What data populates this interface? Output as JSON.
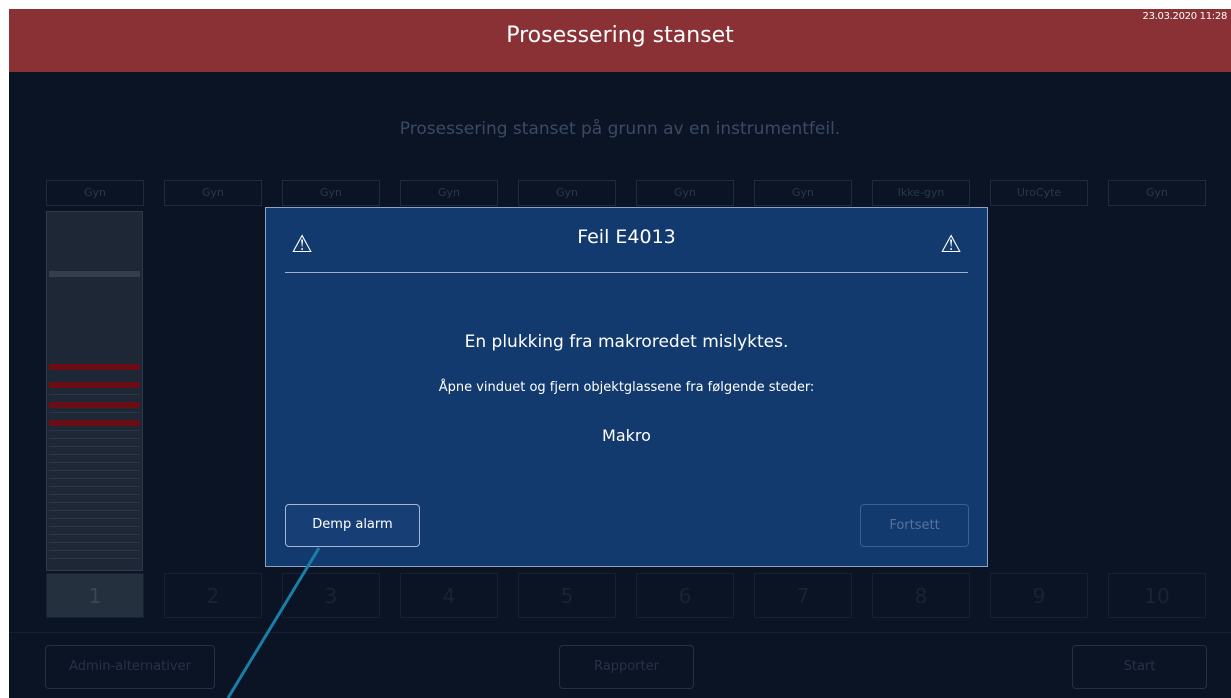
{
  "header": {
    "title": "Prosessering stanset",
    "datetime": "23.03.2020 11:28"
  },
  "status_message": "Prosessering stanset på grunn av en instrumentfeil.",
  "racks": [
    {
      "label": "Gyn",
      "number": "1"
    },
    {
      "label": "Gyn",
      "number": "2"
    },
    {
      "label": "Gyn",
      "number": "3"
    },
    {
      "label": "Gyn",
      "number": "4"
    },
    {
      "label": "Gyn",
      "number": "5"
    },
    {
      "label": "Gyn",
      "number": "6"
    },
    {
      "label": "Gyn",
      "number": "7"
    },
    {
      "label": "Ikke-gyn",
      "number": "8"
    },
    {
      "label": "UroCyte",
      "number": "9"
    },
    {
      "label": "Gyn",
      "number": "10"
    }
  ],
  "footer": {
    "admin_label": "Admin-alternativer",
    "reports_label": "Rapporter",
    "start_label": "Start"
  },
  "dialog": {
    "title": "Feil E4013",
    "icon": "warning-icon",
    "message": "En plukking fra makroredet mislyktes.",
    "instruction": "Åpne vinduet og fjern objektglassene fra følgende steder:",
    "location": "Makro",
    "mute_label": "Demp alarm",
    "continue_label": "Fortsett"
  },
  "colors": {
    "header_bg": "#8a3135",
    "screen_bg": "#0a1424",
    "dialog_bg": "#123a6e",
    "error_slot": "#6b0d14",
    "pointer": "#1a7fa8"
  }
}
